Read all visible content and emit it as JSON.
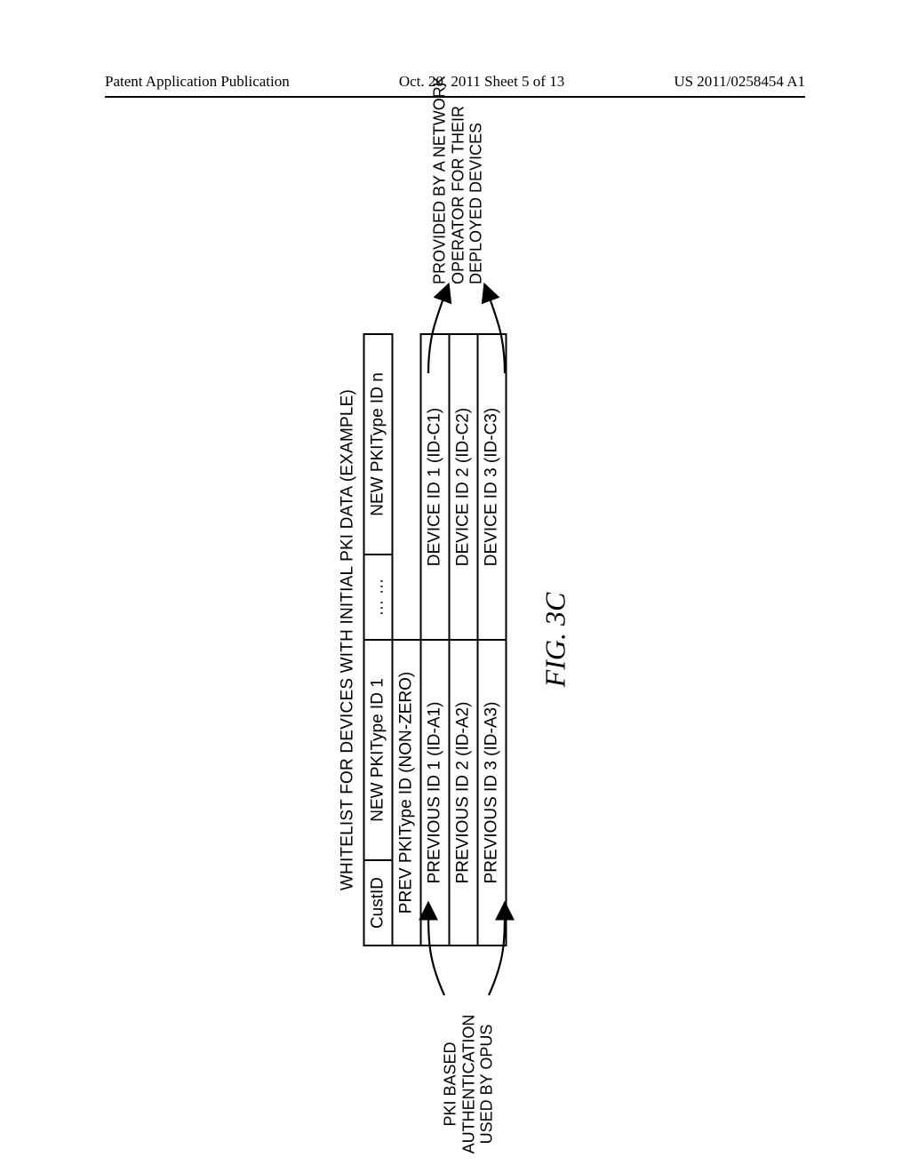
{
  "header": {
    "left": "Patent Application Publication",
    "center": "Oct. 20, 2011   Sheet 5 of 13",
    "right": "US 2011/0258454 A1"
  },
  "figure": {
    "title": "WHITELIST FOR DEVICES WITH INITIAL PKI DATA (EXAMPLE)",
    "caption": "FIG. 3C",
    "header_row": {
      "c0": "CustID",
      "c1": "NEW PKIType ID 1",
      "c2": "… …",
      "c3": "NEW PKIType ID n"
    },
    "prev_row": "PREV PKIType ID (NON-ZERO)",
    "rows": [
      {
        "prev": "PREVIOUS ID 1 (ID-A1)",
        "dev": "DEVICE ID 1 (ID-C1)"
      },
      {
        "prev": "PREVIOUS ID 2 (ID-A2)",
        "dev": "DEVICE ID 2 (ID-C2)"
      },
      {
        "prev": "PREVIOUS ID 3 (ID-A3)",
        "dev": "DEVICE ID 3 (ID-C3)"
      }
    ],
    "anno_left_l1": "PKI BASED",
    "anno_left_l2": "AUTHENTICATION",
    "anno_left_l3": "USED BY OPUS",
    "anno_right_l1": "PROVIDED BY A NETWORK",
    "anno_right_l2": "OPERATOR FOR THEIR",
    "anno_right_l3": "DEPLOYED DEVICES"
  }
}
